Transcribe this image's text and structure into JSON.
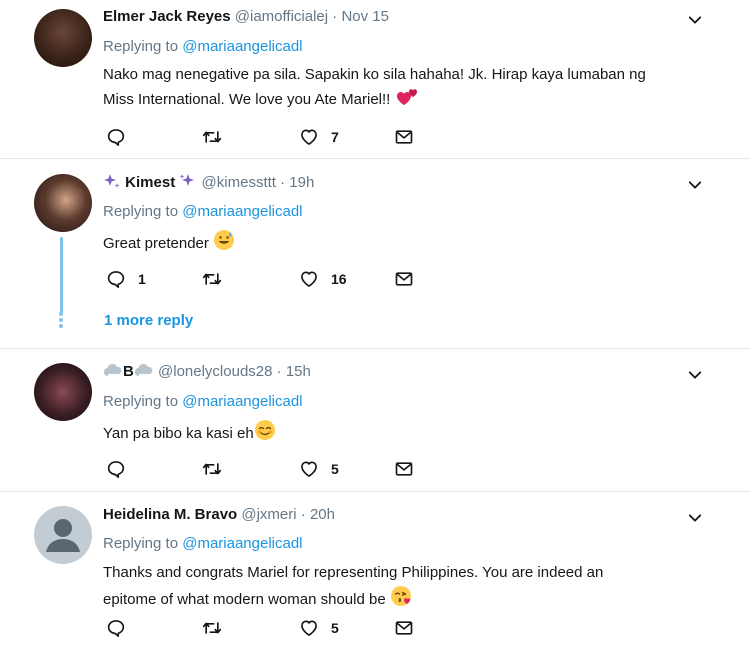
{
  "tweets": [
    {
      "name": "Elmer Jack Reyes",
      "handle": "@iamofficialej",
      "time": "· Nov 15",
      "replying_label": "Replying to",
      "replying_to": "@mariaangelicadl",
      "text_line1": "Nako mag nenegative pa sila. Sapakin ko sila hahaha! Jk. Hirap kaya lumaban ng",
      "text_line2": "Miss International. We love you Ate Mariel!!",
      "emoji": "two-hearts",
      "reply_count": "",
      "retweet_count": "",
      "like_count": "7"
    },
    {
      "name": "Kimest",
      "handle": "@kimessttt",
      "time": "· 19h",
      "replying_label": "Replying to",
      "replying_to": "@mariaangelicadl",
      "text_line1": "Great pretender",
      "emoji": "grinning-sweat",
      "reply_count": "1",
      "retweet_count": "",
      "like_count": "16",
      "more_replies": "1 more reply"
    },
    {
      "name": "B",
      "handle": "@lonelyclouds28",
      "time": "· 15h",
      "replying_label": "Replying to",
      "replying_to": "@mariaangelicadl",
      "text_line1": "Yan pa bibo ka kasi eh",
      "emoji": "relieved-face",
      "reply_count": "",
      "retweet_count": "",
      "like_count": "5"
    },
    {
      "name": "Heidelina M. Bravo",
      "handle": "@jxmeri",
      "time": "· 20h",
      "replying_label": "Replying to",
      "replying_to": "@mariaangelicadl",
      "text_line1": "Thanks and congrats Mariel for representing Philippines. You are indeed an",
      "text_line2": "epitome of what modern woman should be",
      "emoji": "kissing-heart",
      "reply_count": "",
      "retweet_count": "",
      "like_count": "5"
    }
  ],
  "colors": {
    "link": "#1b95e0",
    "muted": "#657786",
    "text": "#14171a",
    "divider": "#e1e8ed",
    "thread": "#80c2ee"
  },
  "icons": [
    "reply-icon",
    "retweet-icon",
    "like-icon",
    "dm-icon",
    "chevron-down-icon",
    "sparkles-icon",
    "cloud-icon"
  ]
}
